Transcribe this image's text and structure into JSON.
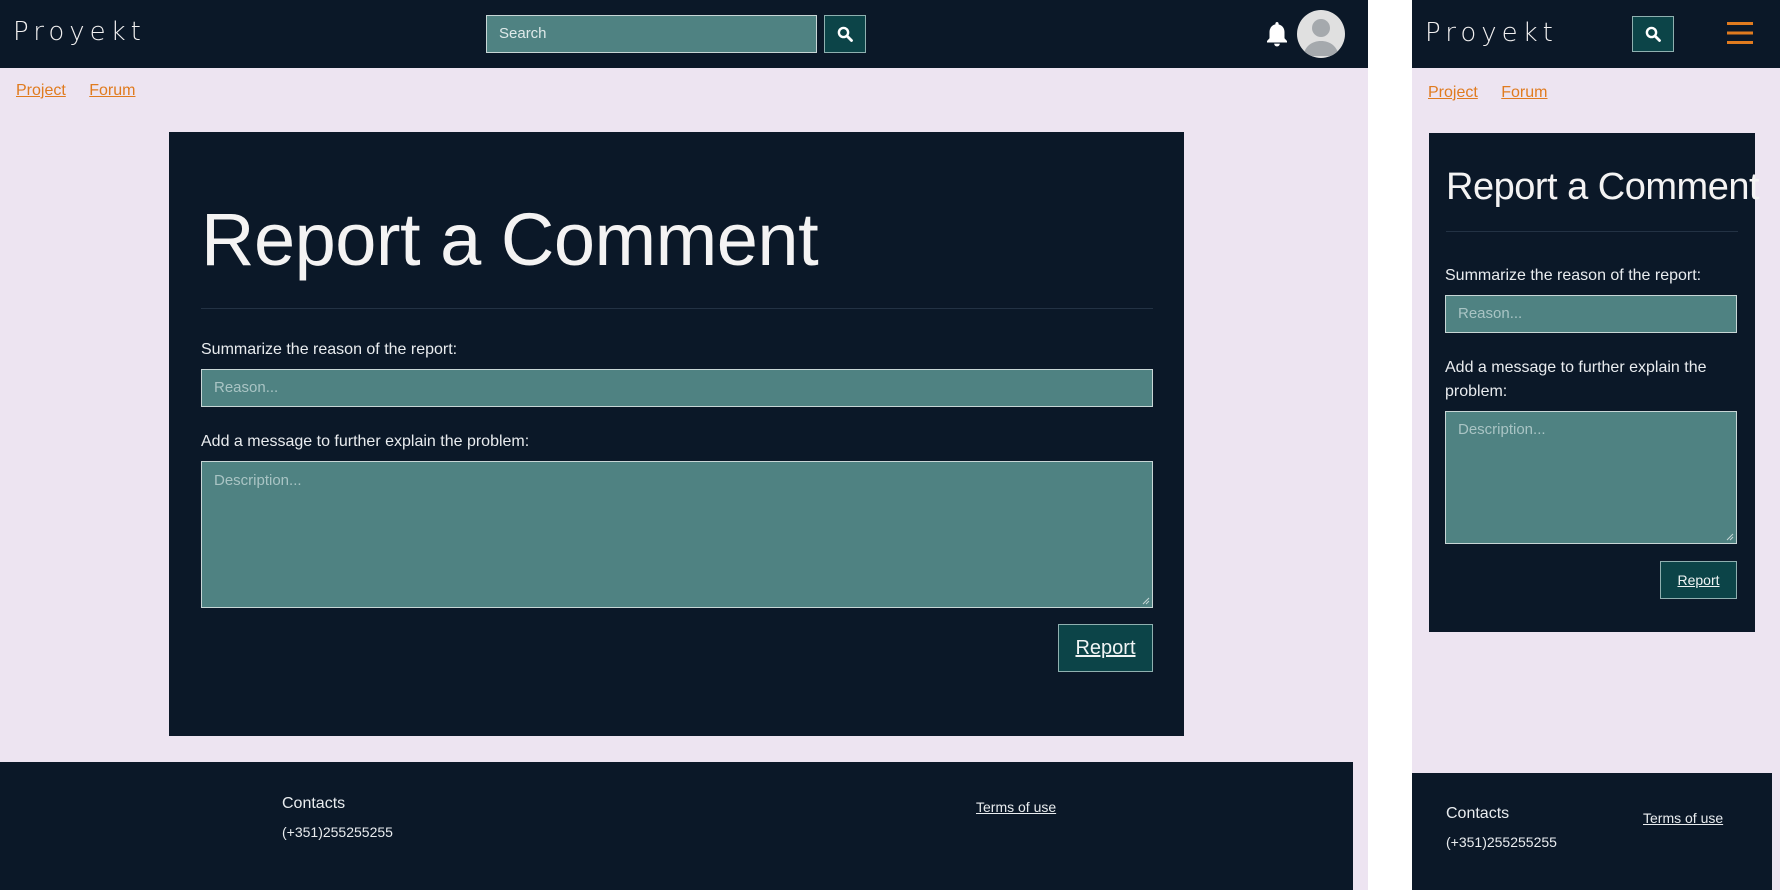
{
  "header": {
    "logo": "Proyekt",
    "search_placeholder": "Search"
  },
  "breadcrumbs": [
    "Project",
    "Forum"
  ],
  "report_form": {
    "title": "Report a Comment",
    "reason_label": "Summarize the reason of the report:",
    "reason_placeholder": "Reason...",
    "message_label": "Add a message to further explain the problem:",
    "message_label_line1": "Add a message to further explain the",
    "message_label_line2": "problem:",
    "message_placeholder": "Description...",
    "submit_label": "Report"
  },
  "footer": {
    "contacts_title": "Contacts",
    "phone": "(+351)255255255",
    "terms_label": "Terms of use"
  },
  "colors": {
    "header_bg": "#0b1828",
    "page_bg": "#ede4f1",
    "field_bg": "#4f8282",
    "button_bg": "#0c4448",
    "link_accent": "#e07b1f"
  },
  "icons": {
    "search": "magnifier-icon",
    "notifications": "bell-icon",
    "profile": "avatar",
    "menu": "hamburger-icon"
  }
}
